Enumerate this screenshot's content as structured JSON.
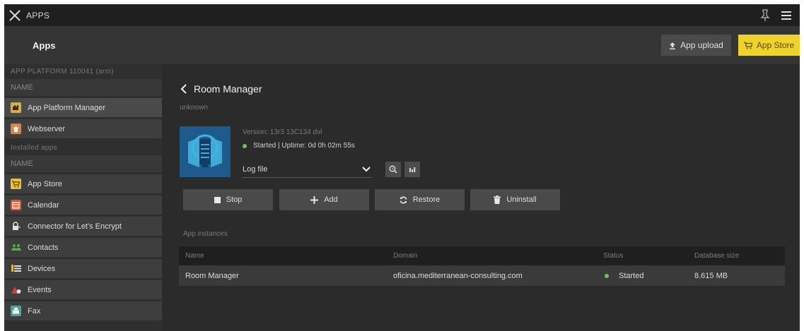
{
  "topbar": {
    "title": "APPS"
  },
  "subbar": {
    "title": "Apps",
    "upload_label": "App upload",
    "store_label": "App Store"
  },
  "sidebar": {
    "platform_header": "APP PLATFORM 110041 (arm)",
    "col_name": "NAME",
    "platform_items": [
      {
        "label": "App Platform Manager",
        "icon": "puzzle-icon",
        "color": "#d6b23a"
      },
      {
        "label": "Webserver",
        "icon": "webserver-icon",
        "color": "#e0823a"
      }
    ],
    "installed_header": "Installed apps",
    "installed_col_name": "NAME",
    "installed_items": [
      {
        "label": "App Store",
        "icon": "cart-icon",
        "color": "#f0c02c"
      },
      {
        "label": "Calendar",
        "icon": "calendar-icon",
        "color": "#e0552f"
      },
      {
        "label": "Connector for Let's Encrypt",
        "icon": "lock-icon",
        "color": "#d8d8d8"
      },
      {
        "label": "Contacts",
        "icon": "contacts-icon",
        "color": "#5aa947"
      },
      {
        "label": "Devices",
        "icon": "devices-icon",
        "color": "#e8b43a"
      },
      {
        "label": "Events",
        "icon": "events-icon",
        "color": "#d93a3a"
      },
      {
        "label": "Fax",
        "icon": "fax-icon",
        "color": "#3aa9a0"
      }
    ]
  },
  "app": {
    "name": "Room Manager",
    "vendor": "unknown",
    "version": "Version: 13r3 13C134 dvl",
    "status": "Started | Uptime: 0d 0h 02m 55s",
    "log_select": "Log file"
  },
  "actions": {
    "stop": "Stop",
    "add": "Add",
    "restore": "Restore",
    "uninstall": "Uninstall"
  },
  "instances": {
    "label": "App instances",
    "columns": [
      "Name",
      "Domain",
      "Status",
      "Database size"
    ],
    "rows": [
      {
        "name": "Room Manager",
        "domain": "oficina.mediterranean-consulting.com",
        "status": "Started",
        "db_size": "8.615 MB"
      }
    ]
  },
  "colors": {
    "accent": "#f0d22c",
    "status_ok": "#6ac259"
  }
}
